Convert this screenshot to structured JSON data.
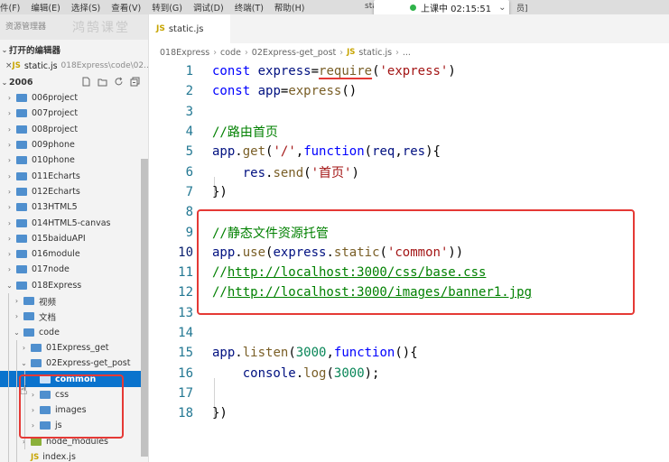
{
  "menu": {
    "items": [
      "件(F)",
      "编辑(E)",
      "选择(S)",
      "查看(V)",
      "转到(G)",
      "调试(D)",
      "终端(T)",
      "帮助(H)"
    ],
    "window_title_left": "sta",
    "window_title_right": "员]"
  },
  "live_badge": {
    "label": "上课中 02:15:51",
    "chevron": "⌄",
    "dot_color": "#2fb34a"
  },
  "sidebar": {
    "header_label": "资源管理器",
    "logo_text": "鸿鹄课堂",
    "open_editors_label": "打开的编辑器",
    "open_file": {
      "close": "×",
      "badge": "JS",
      "name": "static.js",
      "path": "018Express\\code\\02..."
    },
    "root_label": "2006",
    "root_actions": [
      "new-file-icon",
      "new-folder-icon",
      "refresh-icon",
      "collapse-all-icon"
    ],
    "tree": [
      {
        "label": "006project",
        "chev": "›",
        "level": 0
      },
      {
        "label": "007project",
        "chev": "›",
        "level": 0
      },
      {
        "label": "008project",
        "chev": "›",
        "level": 0
      },
      {
        "label": "009phone",
        "chev": "›",
        "level": 0
      },
      {
        "label": "010phone",
        "chev": "›",
        "level": 0
      },
      {
        "label": "011Echarts",
        "chev": "›",
        "level": 0
      },
      {
        "label": "012Echarts",
        "chev": "›",
        "level": 0
      },
      {
        "label": "013HTML5",
        "chev": "›",
        "level": 0
      },
      {
        "label": "014HTML5-canvas",
        "chev": "›",
        "level": 0
      },
      {
        "label": "015baiduAPI",
        "chev": "›",
        "level": 0
      },
      {
        "label": "016module",
        "chev": "›",
        "level": 0
      },
      {
        "label": "017node",
        "chev": "›",
        "level": 0
      },
      {
        "label": "018Express",
        "chev": "⌄",
        "level": 0
      },
      {
        "label": "视频",
        "chev": "›",
        "level": 1
      },
      {
        "label": "文档",
        "chev": "›",
        "level": 1
      },
      {
        "label": "code",
        "chev": "⌄",
        "level": 1
      },
      {
        "label": "01Express_get",
        "chev": "›",
        "level": 2
      },
      {
        "label": "02Express-get_post",
        "chev": "⌄",
        "level": 2
      },
      {
        "label": "common",
        "chev": "",
        "level": 3,
        "selected": true
      },
      {
        "label": "css",
        "chev": "›",
        "level": 3
      },
      {
        "label": "images",
        "chev": "›",
        "level": 3
      },
      {
        "label": "js",
        "chev": "›",
        "level": 3
      },
      {
        "label": "node_modules",
        "chev": "›",
        "level": 2
      },
      {
        "label": "index.js",
        "chev": "",
        "level": 2
      }
    ]
  },
  "editor": {
    "tab": {
      "badge": "JS",
      "label": "static.js"
    },
    "breadcrumb": [
      "018Express",
      "code",
      "02Express-get_post",
      "static.js",
      "..."
    ],
    "breadcrumb_sep": "›",
    "line_numbers": [
      "1",
      "2",
      "3",
      "4",
      "5",
      "6",
      "7",
      "8",
      "9",
      "10",
      "11",
      "12",
      "13",
      "14",
      "15",
      "16",
      "17",
      "18"
    ],
    "active_line": "10"
  },
  "colors": {
    "accent_selection": "#0a73cd",
    "annotation_red": "#e53935",
    "keyword": "#0000ff",
    "string": "#a31515",
    "comment": "#008000"
  }
}
